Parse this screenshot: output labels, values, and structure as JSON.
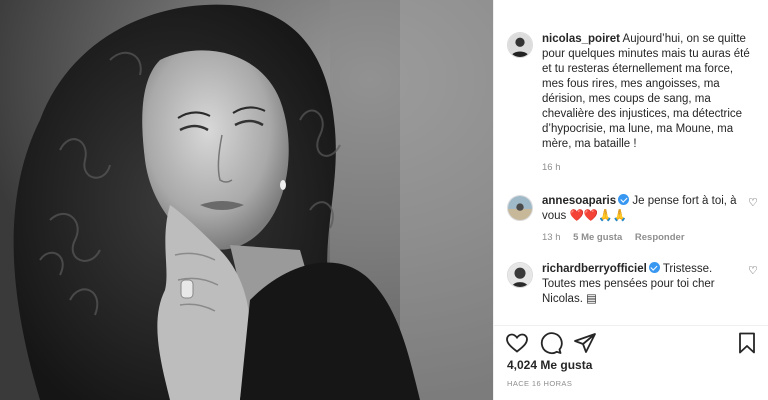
{
  "post": {
    "image_alt_icon": "portrait-photo",
    "author": "nicolas_poiret",
    "caption": "Aujourd’hui, on se quitte pour quelques minutes mais tu auras été et tu resteras éternellement ma force, mes fous rires, mes angoisses, ma dérision, mes coups de sang, ma chevalière des injustices, ma détectrice d’hypocrisie, ma lune, ma Moune, ma mère, ma bataille !",
    "caption_time": "16 h"
  },
  "comments": [
    {
      "username": "annesoaparis",
      "verified": true,
      "text": "Je pense fort à toi, à vous ❤️❤️🙏🙏",
      "time": "13 h",
      "likes": "5 Me gusta",
      "reply": "Responder"
    },
    {
      "username": "richardberryofficiel",
      "verified": true,
      "text": "Tristesse. Toutes mes pensées pour toi cher Nicolas. ▤",
      "time": "",
      "likes": "",
      "reply": ""
    }
  ],
  "actions": {
    "like_icon": "heart-icon",
    "comment_icon": "comment-icon",
    "share_icon": "share-icon",
    "save_icon": "bookmark-icon",
    "likes_count": "4,024 Me gusta",
    "posted": "HACE 16 HORAS"
  }
}
